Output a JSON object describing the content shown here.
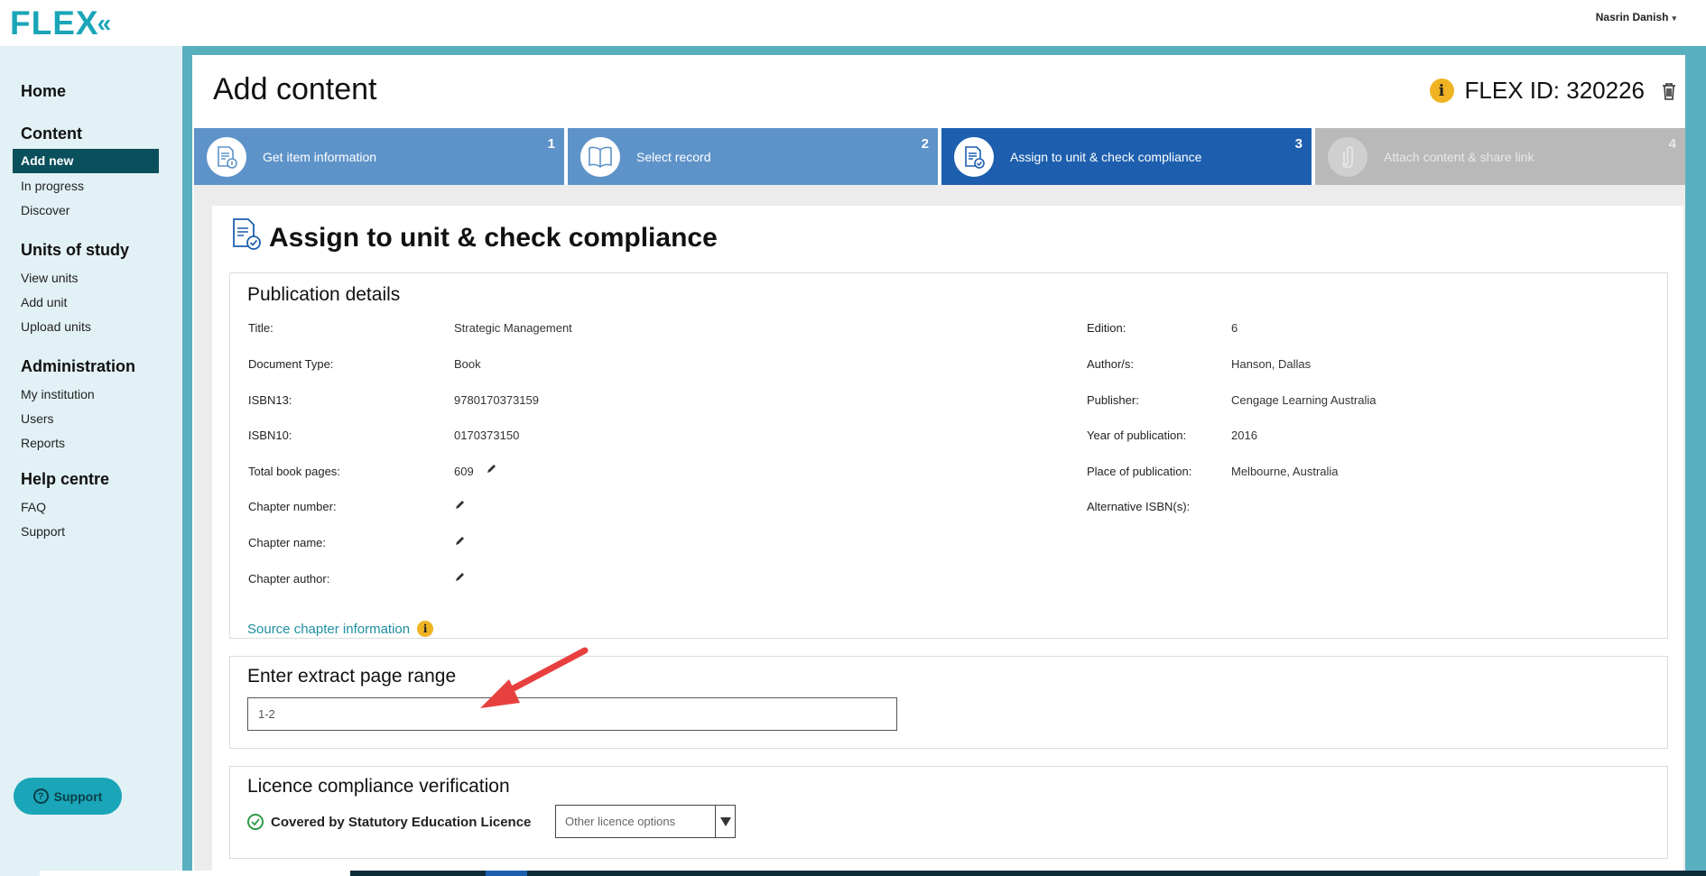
{
  "app": {
    "logo_text": "FLEX",
    "logo_chevron": "«",
    "user_name": "Nasrin Danish",
    "user_caret": "▾"
  },
  "sidebar": {
    "home": "Home",
    "content": {
      "heading": "Content",
      "items": [
        "Add new",
        "In progress",
        "Discover"
      ]
    },
    "units": {
      "heading": "Units of study",
      "items": [
        "View units",
        "Add unit",
        "Upload units"
      ]
    },
    "admin": {
      "heading": "Administration",
      "items": [
        "My institution",
        "Users",
        "Reports"
      ]
    },
    "help": {
      "heading": "Help centre",
      "items": [
        "FAQ",
        "Support"
      ]
    },
    "support_button": "Support"
  },
  "header": {
    "title": "Add content",
    "flex_id_label": "FLEX ID: 320226"
  },
  "steps": [
    {
      "label": "Get item information",
      "number": "1",
      "state": "done",
      "icon": "document-info-icon"
    },
    {
      "label": "Select record",
      "number": "2",
      "state": "done",
      "icon": "open-book-icon"
    },
    {
      "label": "Assign to unit & check compliance",
      "number": "3",
      "state": "current",
      "icon": "document-check-icon"
    },
    {
      "label": "Attach content & share link",
      "number": "4",
      "state": "pending",
      "icon": "paperclip-icon"
    }
  ],
  "section": {
    "title": "Assign to unit & check compliance"
  },
  "publication": {
    "heading": "Publication details",
    "left": [
      {
        "label": "Title:",
        "value": "Strategic Management"
      },
      {
        "label": "Document Type:",
        "value": "Book"
      },
      {
        "label": "ISBN13:",
        "value": "9780170373159"
      },
      {
        "label": "ISBN10:",
        "value": "0170373150"
      },
      {
        "label": "Total book pages:",
        "value": "609"
      },
      {
        "label": "Chapter number:",
        "value": ""
      },
      {
        "label": "Chapter name:",
        "value": ""
      },
      {
        "label": "Chapter author:",
        "value": ""
      }
    ],
    "right": [
      {
        "label": "Edition:",
        "value": "6"
      },
      {
        "label": "Author/s:",
        "value": "Hanson, Dallas"
      },
      {
        "label": "Publisher:",
        "value": "Cengage Learning Australia"
      },
      {
        "label": "Year of publication:",
        "value": "2016"
      },
      {
        "label": "Place of publication:",
        "value": "Melbourne, Australia"
      },
      {
        "label": "Alternative ISBN(s):",
        "value": ""
      }
    ],
    "source_link": "Source chapter information"
  },
  "extract": {
    "heading": "Enter extract page range",
    "value": "1-2"
  },
  "licence": {
    "heading": "Licence compliance verification",
    "status": "Covered by Statutory Education Licence",
    "select_value": "Other licence options"
  },
  "colors": {
    "brand": "#1aa5b8",
    "step_done": "#5e93c9",
    "step_current": "#1d5fae",
    "step_pending": "#b9b9b9",
    "active_nav": "#0a4f5c",
    "info": "#f0b323",
    "annotation_arrow": "#e8403f"
  }
}
